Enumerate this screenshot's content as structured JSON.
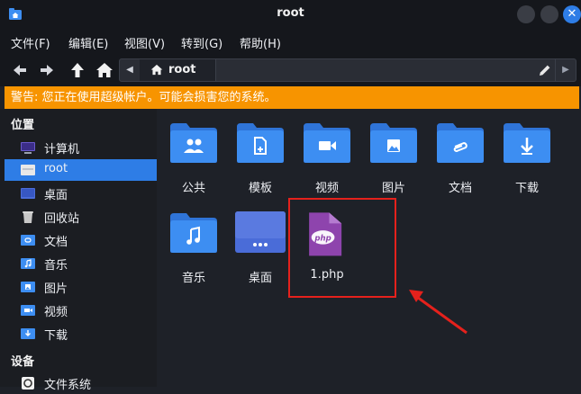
{
  "window": {
    "title": "root"
  },
  "menu": [
    "文件(F)",
    "编辑(E)",
    "视图(V)",
    "转到(G)",
    "帮助(H)"
  ],
  "location": {
    "current": "root"
  },
  "warning": "警告: 您正在使用超级帐户。可能会损害您的系统。",
  "sidebar": {
    "places_header": "位置",
    "places": [
      {
        "label": "计算机",
        "icon": "computer-icon"
      },
      {
        "label": "root",
        "icon": "home-folder-icon",
        "selected": true
      },
      {
        "label": "桌面",
        "icon": "desktop-icon"
      },
      {
        "label": "回收站",
        "icon": "trash-icon"
      },
      {
        "label": "文档",
        "icon": "documents-folder-icon"
      },
      {
        "label": "音乐",
        "icon": "music-folder-icon"
      },
      {
        "label": "图片",
        "icon": "pictures-folder-icon"
      },
      {
        "label": "视频",
        "icon": "videos-folder-icon"
      },
      {
        "label": "下载",
        "icon": "downloads-folder-icon"
      }
    ],
    "devices_header": "设备",
    "devices": [
      {
        "label": "文件系统",
        "icon": "filesystem-icon"
      }
    ]
  },
  "files": [
    {
      "name": "公共",
      "icon": "public-folder-icon"
    },
    {
      "name": "模板",
      "icon": "templates-folder-icon"
    },
    {
      "name": "视频",
      "icon": "videos-folder-icon"
    },
    {
      "name": "图片",
      "icon": "pictures-folder-icon"
    },
    {
      "name": "文档",
      "icon": "documents-folder-icon"
    },
    {
      "name": "下载",
      "icon": "downloads-folder-icon"
    },
    {
      "name": "音乐",
      "icon": "music-folder-icon"
    },
    {
      "name": "桌面",
      "icon": "desktop-folder-icon"
    },
    {
      "name": "1.php",
      "icon": "php-file-icon",
      "badge": "php"
    }
  ],
  "colors": {
    "accent": "#2e7de6",
    "warning": "#f79400",
    "folder": "#3d8ef2",
    "php": "#8e44ad",
    "highlight": "#e5211c"
  }
}
